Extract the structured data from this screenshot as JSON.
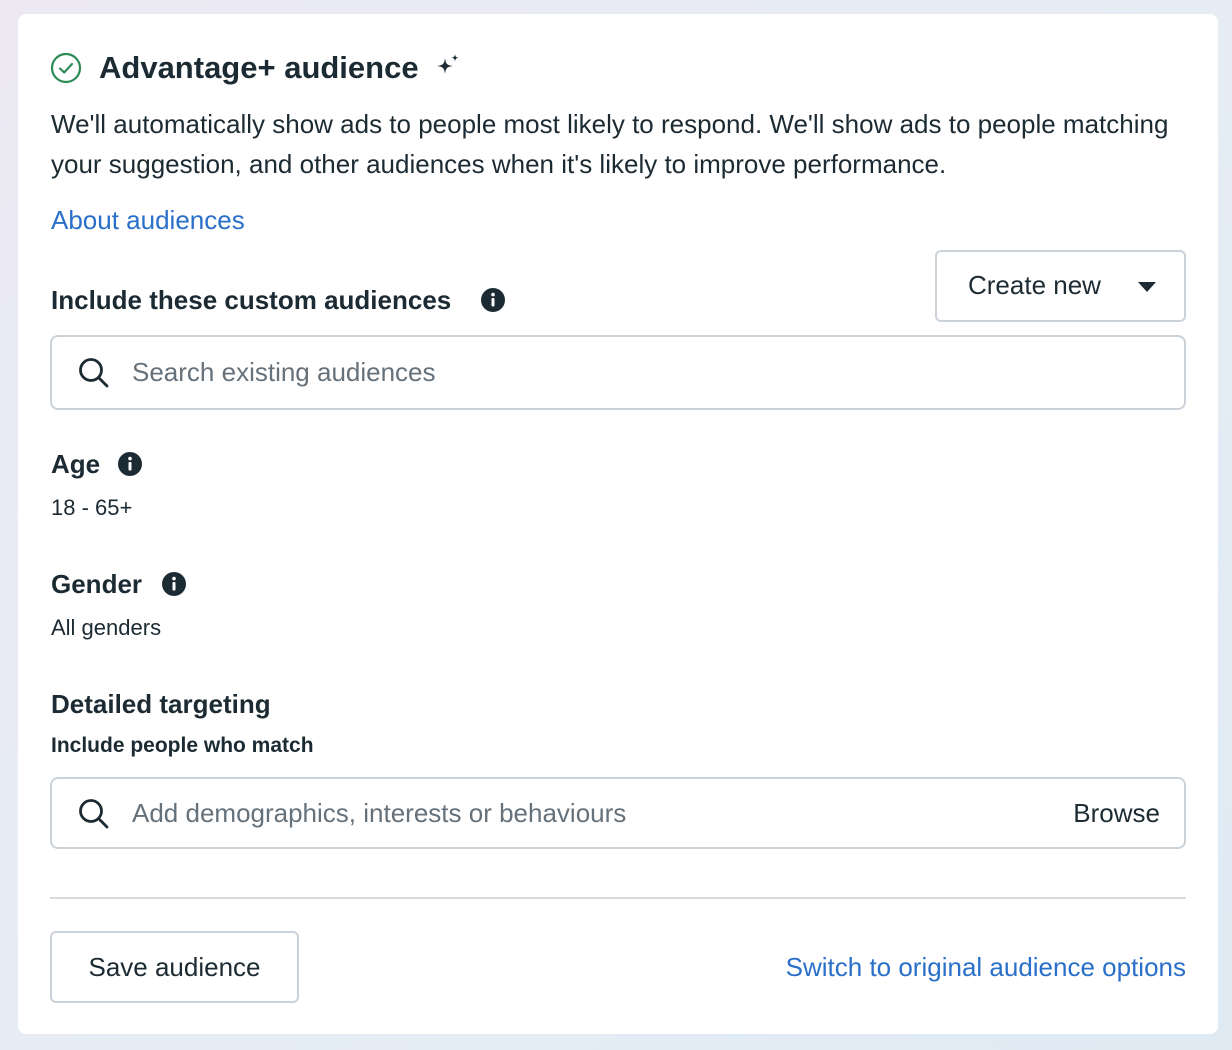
{
  "header": {
    "title": "Advantage+ audience",
    "status_icon": "check-circle-icon",
    "sparkle_icon": "sparkle-icon",
    "description": "We'll automatically show ads to people most likely to respond. We'll show ads to people matching your suggestion, and other audiences when it's likely to improve performance.",
    "about_link": "About audiences"
  },
  "custom_audiences": {
    "label": "Include these custom audiences",
    "create_button": "Create new",
    "search_placeholder": "Search existing audiences"
  },
  "age": {
    "label": "Age",
    "value": "18 - 65+"
  },
  "gender": {
    "label": "Gender",
    "value": "All genders"
  },
  "detailed_targeting": {
    "label": "Detailed targeting",
    "sub_label": "Include people who match",
    "search_placeholder": "Add demographics, interests or behaviours",
    "browse_label": "Browse"
  },
  "footer": {
    "save_button": "Save audience",
    "switch_link": "Switch to original audience options"
  },
  "colors": {
    "link": "#2a6fc9",
    "success": "#2e8b57",
    "text": "#1c2b33",
    "border": "#cbd2d9"
  }
}
